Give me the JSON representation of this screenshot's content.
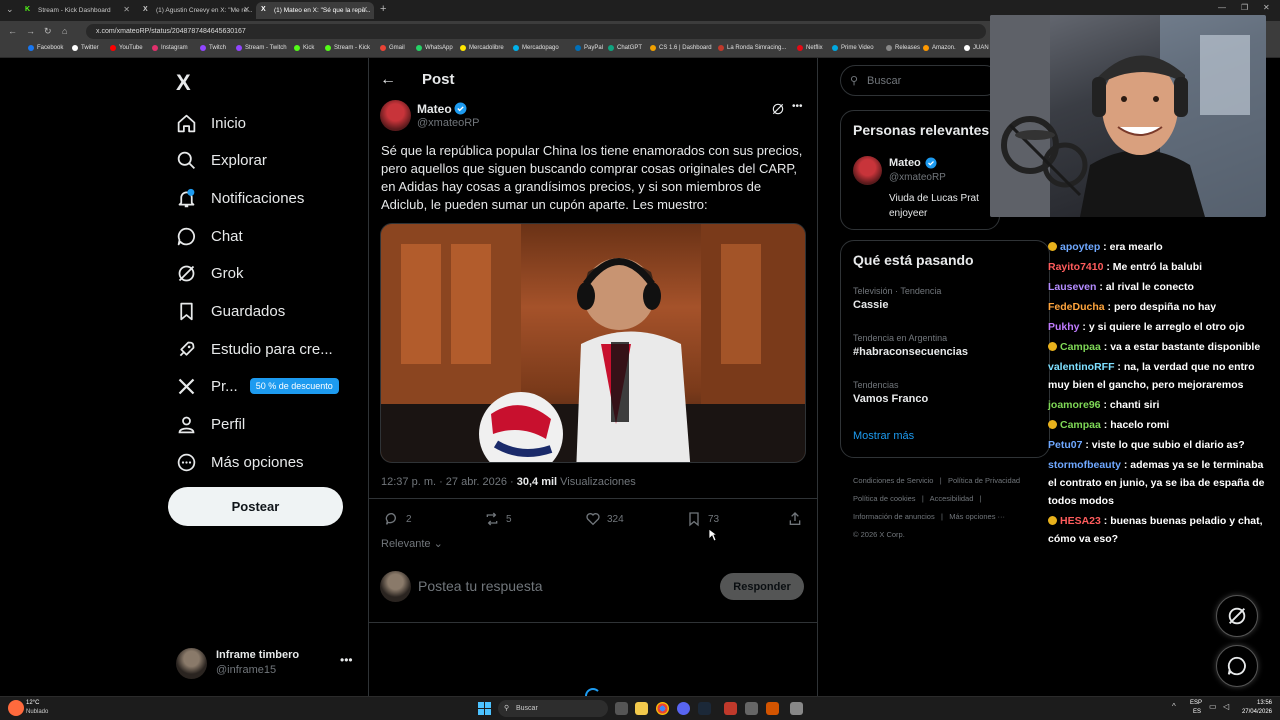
{
  "browser": {
    "tabs": [
      {
        "title": "Stream - Kick Dashboard",
        "favicon": "kick-icon",
        "active": false
      },
      {
        "title": "(1) Agustin Creevy en X: \"Me re...",
        "favicon": "x-icon",
        "active": false
      },
      {
        "title": "(1) Mateo en X: \"Sé que la repú...",
        "favicon": "x-icon",
        "active": true
      }
    ],
    "url": "x.com/xmateoRP/status/2048787484645630167",
    "bookmarks": [
      "Facebook",
      "Twitter",
      "YouTube",
      "Instagram",
      "Twitch",
      "Stream - Twitch",
      "Kick",
      "Stream - Kick",
      "Gmail",
      "WhatsApp",
      "Mercadolibre",
      "Mercadopago",
      "PayPal",
      "ChatGPT",
      "CS 1.6 | Dashboard",
      "La Ronda Simracing...",
      "Netflix",
      "Prime Video",
      "Releases",
      "Amazon.",
      "JUAN"
    ]
  },
  "sidebar": {
    "logo": "X",
    "items": [
      {
        "label": "Inicio",
        "icon": "home-icon"
      },
      {
        "label": "Explorar",
        "icon": "search-icon"
      },
      {
        "label": "Notificaciones",
        "icon": "bell-icon",
        "badge": "1"
      },
      {
        "label": "Chat",
        "icon": "chat-icon"
      },
      {
        "label": "Grok",
        "icon": "grok-icon"
      },
      {
        "label": "Guardados",
        "icon": "bookmark-icon"
      },
      {
        "label": "Estudio para cre...",
        "icon": "rocket-icon"
      },
      {
        "label": "Pr...",
        "icon": "x-premium-icon",
        "promo": "50 % de descuento"
      },
      {
        "label": "Perfil",
        "icon": "person-icon"
      },
      {
        "label": "Más opciones",
        "icon": "more-circle-icon"
      }
    ],
    "post_button": "Postear",
    "account": {
      "name": "Inframe timbero",
      "handle": "@inframe15"
    }
  },
  "post": {
    "header": "Post",
    "author": {
      "name": "Mateo",
      "handle": "@xmateoRP",
      "verified": true
    },
    "text": "Sé que la república popular China los tiene enamorados con sus precios, pero aquellos que siguen buscando comprar cosas originales del CARP, en Adidas hay  cosas a grandísimos precios, y si son miembros de Adiclub, le pueden sumar un cupón aparte. Les muestro:",
    "time": "12:37 p. m. · 27 abr. 2026 · ",
    "views_count": "30,4 mil",
    "views_label": " Visualizaciones",
    "stats": {
      "replies": "2",
      "reposts": "5",
      "likes": "324",
      "bookmarks": "73"
    },
    "sort_label": "Relevante",
    "reply_placeholder": "Postea tu respuesta",
    "reply_button": "Responder"
  },
  "right": {
    "search_placeholder": "Buscar",
    "relevant": {
      "title": "Personas relevantes",
      "name": "Mateo",
      "handle": "@xmateoRP",
      "bio": "Viuda de Lucas Prat enjoyeer"
    },
    "trends": {
      "title": "Qué está pasando",
      "items": [
        {
          "category": "Televisión · Tendencia",
          "name": "Cassie"
        },
        {
          "category": "Tendencia en Argentina",
          "name": "#habraconsecuencias"
        },
        {
          "category": "Tendencias",
          "name": "Vamos Franco"
        }
      ],
      "more": "Mostrar más"
    },
    "footer": [
      "Condiciones de Servicio",
      "|",
      "Política de Privacidad",
      "Política de cookies",
      "|",
      "Accesibilidad",
      "|",
      "Información de anuncios",
      "|",
      "Más opciones ···",
      "© 2026 X Corp."
    ]
  },
  "chat": [
    {
      "user": "apoytep",
      "color": "#6fa8ff",
      "badge": true,
      "text": "era mearlo"
    },
    {
      "user": "Rayito7410",
      "color": "#ff5c5c",
      "badge": false,
      "text": "Me entró la balubi"
    },
    {
      "user": "Lauseven",
      "color": "#b48cff",
      "badge": false,
      "text": "al rival le conecto"
    },
    {
      "user": "FedeDucha",
      "color": "#ffa53d",
      "badge": false,
      "text": "pero despiña no hay"
    },
    {
      "user": "Pukhy",
      "color": "#c07cff",
      "badge": false,
      "text": "y si quiere le arreglo el otro ojo"
    },
    {
      "user": "Campaa",
      "color": "#7fd857",
      "badge": true,
      "text": "va a estar bastante disponible"
    },
    {
      "user": "valentinoRFF",
      "color": "#7fe0ff",
      "badge": false,
      "text": "na, la verdad que no entro muy bien el gancho, pero mejoraremos"
    },
    {
      "user": "joamore96",
      "color": "#7fd857",
      "badge": false,
      "text": "chanti siri"
    },
    {
      "user": "Campaa",
      "color": "#7fd857",
      "badge": true,
      "text": "hacelo romi"
    },
    {
      "user": "Petu07",
      "color": "#6fa8ff",
      "badge": false,
      "text": "viste lo que subio el diario as?"
    },
    {
      "user": "stormofbeauty",
      "color": "#6fa8ff",
      "badge": false,
      "text": "ademas ya se le terminaba el contrato en junio, ya se iba de españa de todos modos"
    },
    {
      "user": "HESA23",
      "color": "#ff5c5c",
      "badge": true,
      "text": "buenas buenas peladio y chat, cómo va eso?"
    }
  ],
  "taskbar": {
    "weather_temp": "12°C",
    "weather_text": "Nublado",
    "search": "Buscar",
    "lang": "ESP",
    "lang2": "ES",
    "time": "13:56",
    "date": "27/04/2026"
  },
  "colors": {
    "accent": "#1d9bf0",
    "bg": "#000000",
    "border": "#2f3336",
    "muted": "#71767b"
  }
}
